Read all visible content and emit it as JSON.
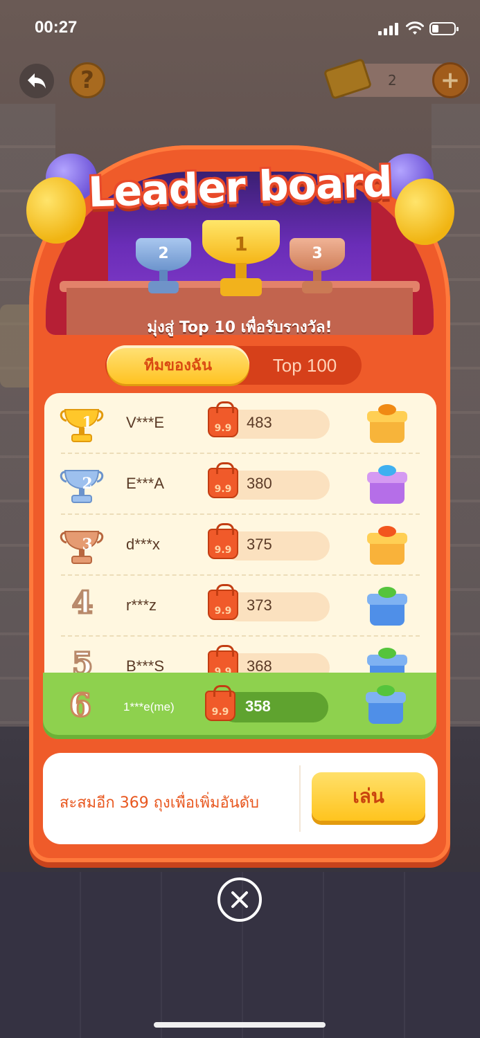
{
  "status_bar": {
    "time": "00:27"
  },
  "top_bar": {
    "help_label": "?",
    "tickets": "2",
    "add_label": "+"
  },
  "board": {
    "title": "Leader board",
    "subtitle": "มุ่งสู่ Top 10 เพื่อรับรางวัล!",
    "trophies": [
      {
        "rank": "2"
      },
      {
        "rank": "1"
      },
      {
        "rank": "3"
      }
    ]
  },
  "tabs": [
    {
      "label": "ทีมของฉัน",
      "active": true
    },
    {
      "label": "Top 100",
      "active": false
    }
  ],
  "bag_label": "9.9",
  "rows": [
    {
      "rank": "1",
      "name": "V***E",
      "score": "483",
      "gift_color": "#f6a21a"
    },
    {
      "rank": "2",
      "name": "E***A",
      "score": "380",
      "gift_color": "#4fb6f0"
    },
    {
      "rank": "3",
      "name": "d***x",
      "score": "375",
      "gift_color": "#f26a1e"
    },
    {
      "rank": "4",
      "name": "r***z",
      "score": "373",
      "gift_color": "#55c43c"
    },
    {
      "rank": "5",
      "name": "B***S",
      "score": "368",
      "gift_color": "#55c43c"
    }
  ],
  "me": {
    "rank": "6",
    "name": "1***e(me)",
    "score": "358"
  },
  "action": {
    "hint": "สะสมอีก 369 ถุงเพื่อเพิ่มอันดับ",
    "play_label": "เล่น"
  },
  "colors": {
    "panel": "#ef5b2a",
    "gold": "#ffc221",
    "silver": "#7fa6d8",
    "bronze": "#d4875e",
    "me_row": "#8ed14e"
  }
}
